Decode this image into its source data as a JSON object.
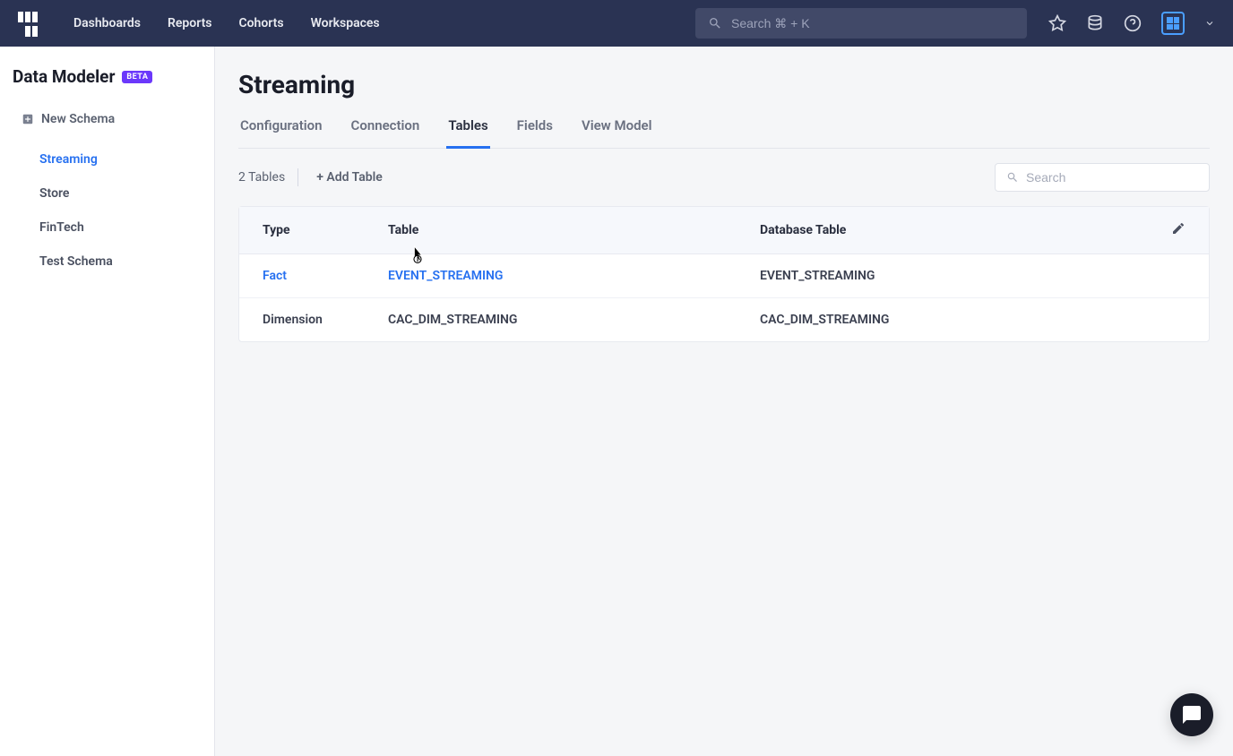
{
  "nav": {
    "links": [
      "Dashboards",
      "Reports",
      "Cohorts",
      "Workspaces"
    ],
    "search_placeholder": "Search ⌘ + K"
  },
  "sidebar": {
    "title": "Data Modeler",
    "beta": "BETA",
    "new_schema": "New Schema",
    "schemas": [
      "Streaming",
      "Store",
      "FinTech",
      "Test Schema"
    ],
    "active_schema_index": 0
  },
  "main": {
    "title": "Streaming",
    "tabs": [
      "Configuration",
      "Connection",
      "Tables",
      "Fields",
      "View Model"
    ],
    "active_tab_index": 2,
    "table_count": "2 Tables",
    "add_table": "+ Add Table",
    "search_placeholder": "Search",
    "columns": [
      "Type",
      "Table",
      "Database Table"
    ],
    "rows": [
      {
        "type": "Fact",
        "table": "EVENT_STREAMING",
        "db": "EVENT_STREAMING",
        "hover": true
      },
      {
        "type": "Dimension",
        "table": "CAC_DIM_STREAMING",
        "db": "CAC_DIM_STREAMING",
        "hover": false
      }
    ]
  }
}
